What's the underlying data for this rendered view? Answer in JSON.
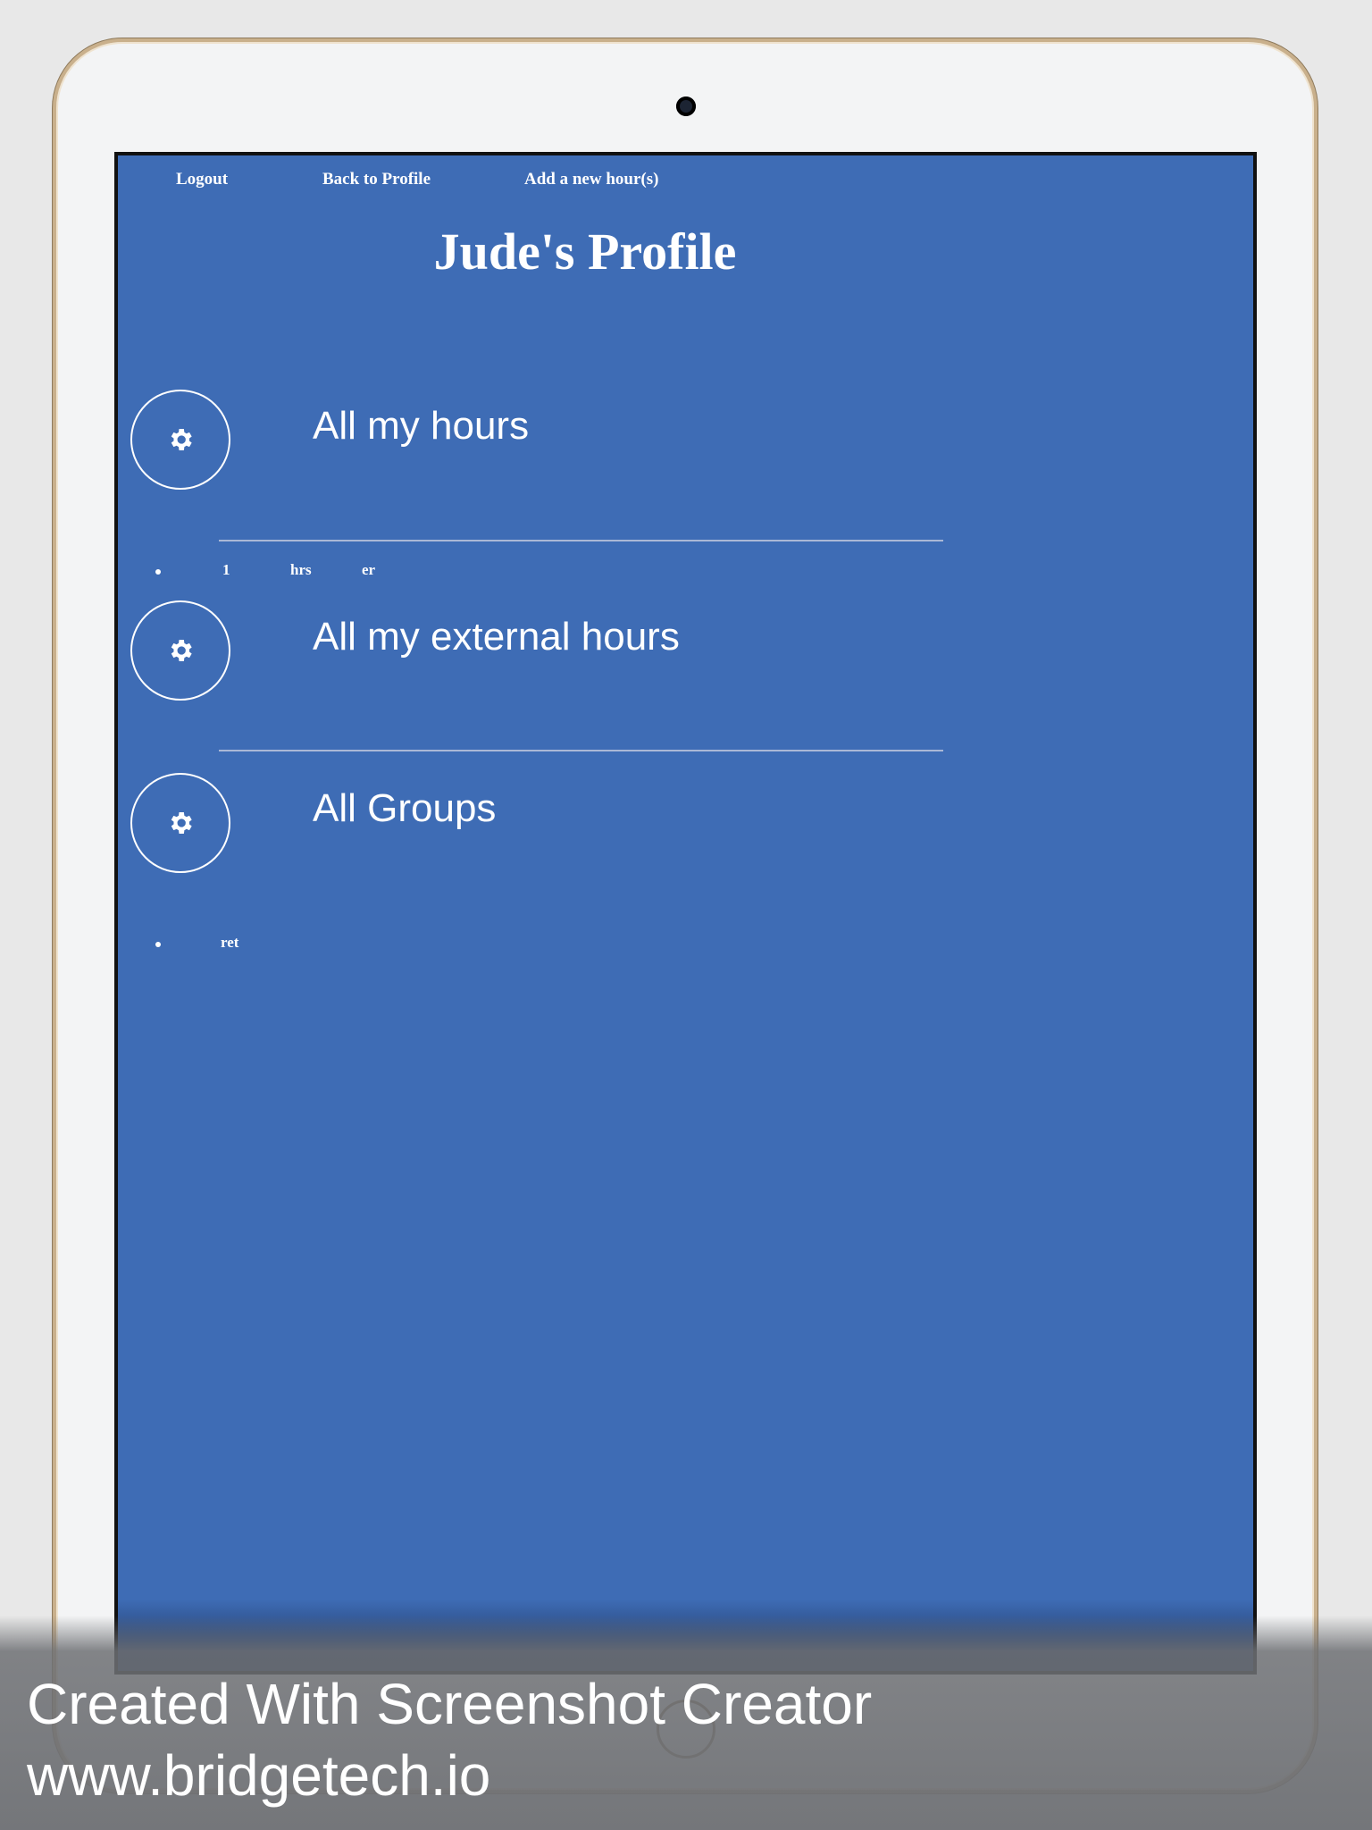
{
  "nav": {
    "logout": "Logout",
    "back_to_profile": "Back to Profile",
    "add_hours": "Add a new hour(s)"
  },
  "profile_title": "Jude's Profile",
  "sections": {
    "my_hours": {
      "label": "All my hours",
      "icon": "gear-icon",
      "rows": [
        {
          "col1": "1",
          "col2": "hrs",
          "col3": "er"
        }
      ]
    },
    "external_hours": {
      "label": "All my external hours",
      "icon": "gear-icon"
    },
    "groups": {
      "label": "All Groups",
      "icon": "gear-icon",
      "rows": [
        {
          "col1": "ret"
        }
      ]
    }
  },
  "watermark": {
    "line1": "Created With Screenshot Creator",
    "line2": "www.bridgetech.io"
  },
  "colors": {
    "screen_background": "#3e6cb5",
    "text": "#ffffff"
  }
}
